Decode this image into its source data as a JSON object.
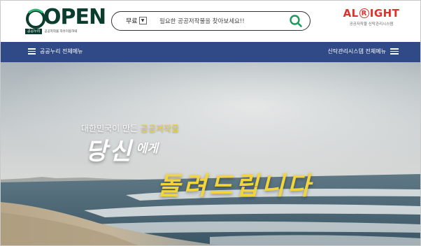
{
  "header": {
    "open_logo": {
      "word": "OPEN",
      "tag": "공공누리",
      "subtitle": "공공저작물 자유이용허락"
    },
    "search": {
      "select_value": "무료",
      "placeholder": "필요한 공공저작물을 찾아보세요!!",
      "button_icon": "search-icon"
    },
    "alright_logo": {
      "word_left": "AL",
      "word_r": "R",
      "word_right": "IGHT",
      "subtitle": "공공저작물 신탁관리시스템"
    }
  },
  "navbar": {
    "left_label": "공공누리 전체메뉴",
    "right_label": "신탁관리시스템 전체메뉴",
    "menu_icon": "hamburger-icon"
  },
  "hero": {
    "line1_prefix": "대한민국이 만든 ",
    "line1_highlight": "공공저작물",
    "line2_main": "당신",
    "line2_suffix": "에게",
    "line3": "돌려드립니다"
  },
  "colors": {
    "brand_green": "#0b3d2e",
    "alright_red": "#e0312b",
    "nav_blue": "#2f4a86",
    "highlight_yellow": "#f2d43b",
    "search_green": "#1a9a5b"
  }
}
